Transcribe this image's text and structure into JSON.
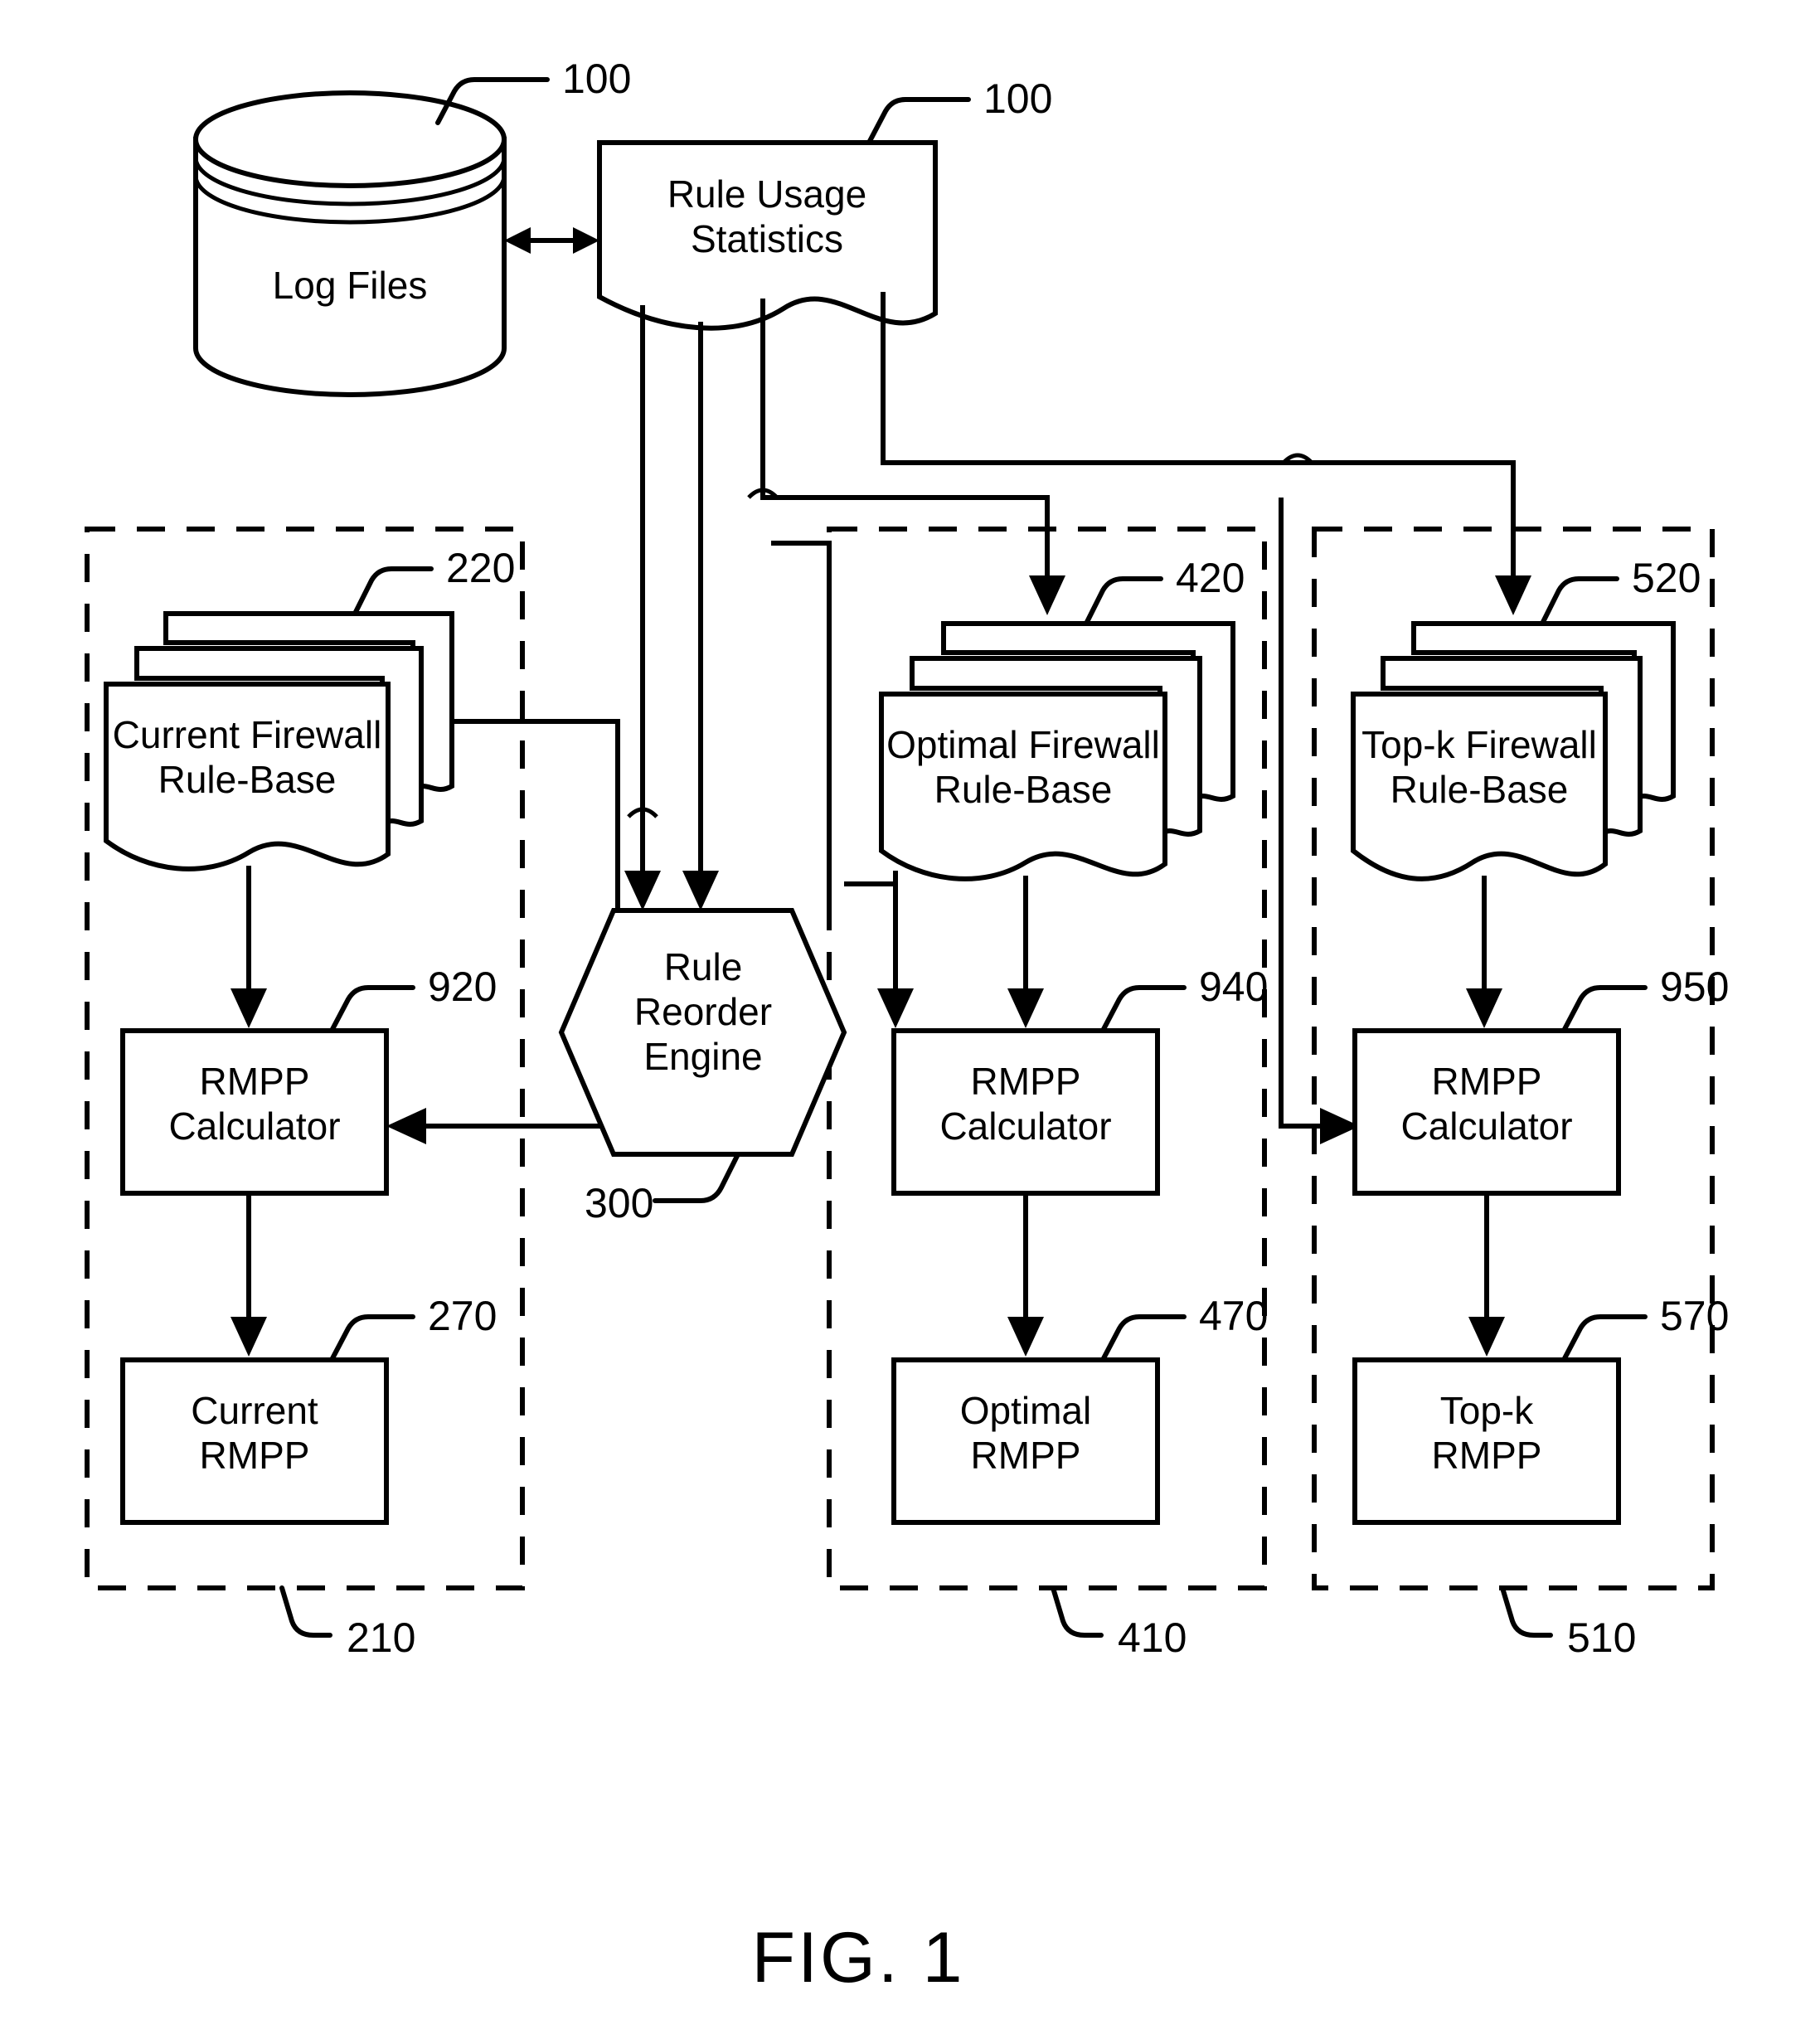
{
  "figure": {
    "caption": "FIG. 1",
    "title": "Firewall rule-base reordering and RMPP comparison block diagram"
  },
  "nodes": {
    "log_files": {
      "label": "Log Files",
      "ref": "100",
      "shape": "cylinder"
    },
    "rule_usage_statistics": {
      "label_line1": "Rule Usage",
      "label_line2": "Statistics",
      "ref": "100",
      "shape": "document"
    },
    "rule_reorder_engine": {
      "label_line1": "Rule",
      "label_line2": "Reorder",
      "label_line3": "Engine",
      "ref": "300",
      "shape": "hexagon"
    }
  },
  "groups": [
    {
      "id": "current",
      "ref": "210",
      "rule_base": {
        "label_line1": "Current Firewall",
        "label_line2": "Rule-Base",
        "ref": "220",
        "shape": "stacked-document"
      },
      "calculator": {
        "label_line1": "RMPP",
        "label_line2": "Calculator",
        "ref": "920",
        "shape": "rect"
      },
      "result": {
        "label_line1": "Current",
        "label_line2": "RMPP",
        "ref": "270",
        "shape": "rect"
      }
    },
    {
      "id": "optimal",
      "ref": "410",
      "rule_base": {
        "label_line1": "Optimal Firewall",
        "label_line2": "Rule-Base",
        "ref": "420",
        "shape": "stacked-document"
      },
      "calculator": {
        "label_line1": "RMPP",
        "label_line2": "Calculator",
        "ref": "940",
        "shape": "rect"
      },
      "result": {
        "label_line1": "Optimal",
        "label_line2": "RMPP",
        "ref": "470",
        "shape": "rect"
      }
    },
    {
      "id": "topk",
      "ref": "510",
      "rule_base": {
        "label_line1": "Top-k Firewall",
        "label_line2": "Rule-Base",
        "ref": "520",
        "shape": "stacked-document"
      },
      "calculator": {
        "label_line1": "RMPP",
        "label_line2": "Calculator",
        "ref": "950",
        "shape": "rect"
      },
      "result": {
        "label_line1": "Top-k",
        "label_line2": "RMPP",
        "ref": "570",
        "shape": "rect"
      }
    }
  ],
  "colors": {
    "ink": "#000000",
    "paper": "#ffffff"
  }
}
